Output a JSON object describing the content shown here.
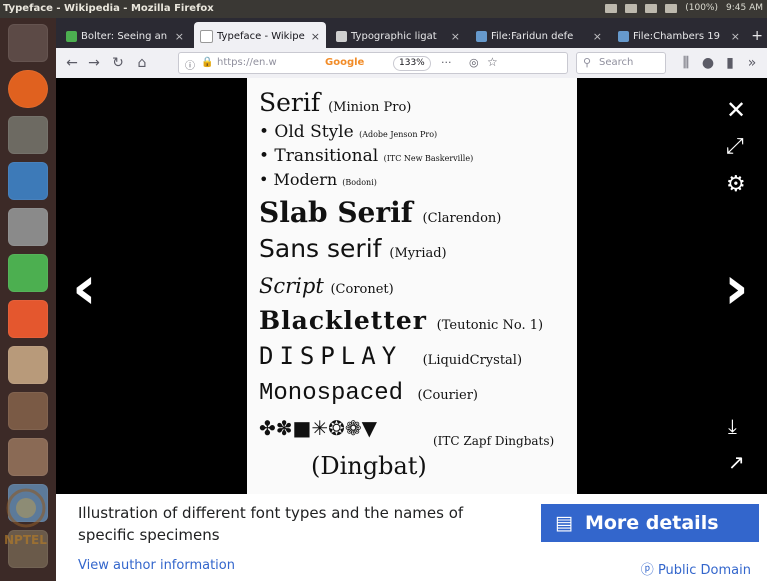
{
  "os": {
    "window_title": "Typeface - Wikipedia - Mozilla Firefox",
    "tray_battery": "(100%)",
    "tray_clock": "9:45 AM"
  },
  "browser": {
    "tabs": [
      {
        "label": "Bolter: Seeing an",
        "close": "×",
        "color": "#4caf50"
      },
      {
        "label": "Typeface - Wikipe",
        "close": "×",
        "color": "#ffffff"
      },
      {
        "label": "Typographic ligat",
        "close": "×",
        "color": "#cfcfcf"
      },
      {
        "label": "File:Faridun defe",
        "close": "×",
        "color": "#6699cc"
      },
      {
        "label": "File:Chambers 19",
        "close": "×",
        "color": "#6699cc"
      }
    ],
    "new_tab": "+",
    "url": "https://en.w",
    "search_engine_badge": "Google",
    "zoom": "133%",
    "search_placeholder": "Search"
  },
  "viewer": {
    "specimens": [
      {
        "main": "Serif",
        "note": "(Minion Pro)"
      },
      {
        "main": "• Old Style",
        "note": "(Adobe Jenson Pro)"
      },
      {
        "main": "• Transitional",
        "note": "(ITC New Baskerville)"
      },
      {
        "main": "• Modern",
        "note": "(Bodoni)"
      },
      {
        "main": "Slab Serif",
        "note": "(Clarendon)"
      },
      {
        "main": "Sans serif",
        "note": "(Myriad)"
      },
      {
        "main": "Script",
        "note": "(Coronet)"
      },
      {
        "main": "Blackletter",
        "note": "(Teutonic No. 1)"
      },
      {
        "main": "DISPLAY",
        "note": "(LiquidCrystal)"
      },
      {
        "main": "Monospaced",
        "note": "(Courier)"
      },
      {
        "main": "✤✽■✳❂❁▼",
        "note": "(ITC Zapf Dingbats)"
      },
      {
        "main": "(Dingbat)",
        "note": ""
      }
    ],
    "controls": {
      "close": "✕",
      "fullscreen": "⤢",
      "settings": "⚙",
      "prev": "‹",
      "next": "›",
      "download": "⤓",
      "share": "↗"
    }
  },
  "info": {
    "caption": "Illustration of different font types and the names of specific specimens",
    "more_details": "More details",
    "author": "View author information",
    "license": "Public Domain"
  },
  "watermark": "NPTEL",
  "colors": {
    "accent": "#3366cc",
    "launcher_bg": "#3c2a27",
    "tab_bar": "#2b2a33"
  }
}
